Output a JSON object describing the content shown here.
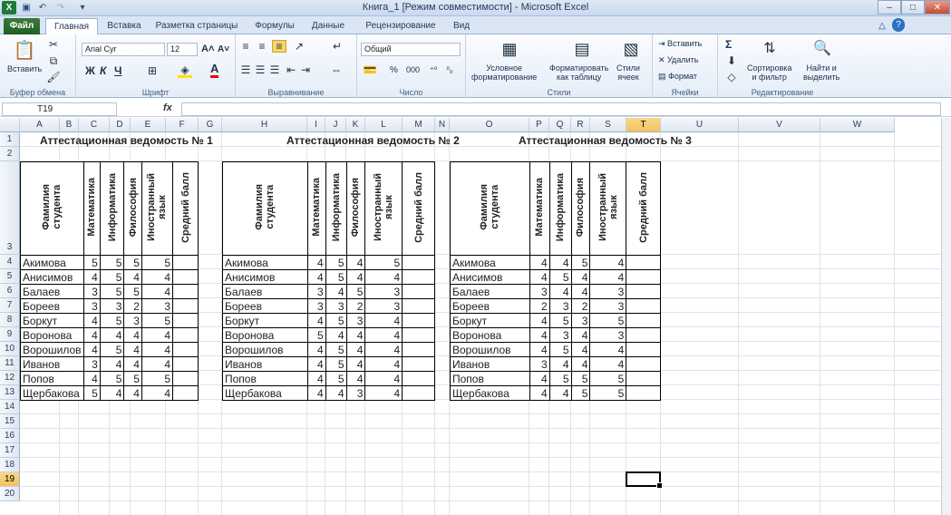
{
  "window": {
    "title": "Книга_1  [Режим совместимости]  -  Microsoft Excel",
    "minimize": "–",
    "maximize": "□",
    "close": "✕"
  },
  "tabs": [
    "Файл",
    "Главная",
    "Вставка",
    "Разметка страницы",
    "Формулы",
    "Данные",
    "Рецензирование",
    "Вид"
  ],
  "ribbon": {
    "clipboard": {
      "paste": "Вставить",
      "label": "Буфер обмена"
    },
    "font": {
      "name": "Arial Cyr",
      "size": "12",
      "bold": "Ж",
      "italic": "К",
      "underline": "Ч",
      "label": "Шрифт",
      "grow": "A˄",
      "shrink": "A˅",
      "color_a": "A"
    },
    "alignment": {
      "label": "Выравнивание"
    },
    "number": {
      "format": "Общий",
      "percent": "%",
      "thousands": "000",
      "label": "Число"
    },
    "styles": {
      "conditional": "Условное\nформатирование",
      "as_table": "Форматировать\nкак таблицу",
      "cell_styles": "Стили\nячеек",
      "label": "Стили"
    },
    "cells": {
      "insert": "Вставить",
      "delete": "Удалить",
      "format": "Формат",
      "label": "Ячейки"
    },
    "editing": {
      "sum": "Σ",
      "sort": "Сортировка\nи фильтр",
      "find": "Найти и\nвыделить",
      "label": "Редактирование"
    }
  },
  "formula_bar": {
    "name_box": "T19",
    "fx": "fx",
    "formula": ""
  },
  "columns": [
    "A",
    "B",
    "C",
    "D",
    "E",
    "F",
    "G",
    "H",
    "I",
    "J",
    "K",
    "L",
    "M",
    "N",
    "O",
    "P",
    "Q",
    "R",
    "S",
    "T",
    "U",
    "V",
    "W"
  ],
  "rows": [
    "1",
    "2",
    "3",
    "4",
    "5",
    "6",
    "7",
    "8",
    "9",
    "10",
    "11",
    "12",
    "13",
    "14",
    "15",
    "16",
    "17",
    "18",
    "19",
    "20"
  ],
  "selected_cell": "T19",
  "header_labels": [
    "Фамилия\nстудента",
    "Математика",
    "Информатика",
    "Философия",
    "Иностранный\nязык",
    "Средний балл"
  ],
  "tables": [
    {
      "title": "Аттестационная ведомость № 1",
      "rows": [
        [
          "Акимова",
          "5",
          "5",
          "5",
          "5"
        ],
        [
          "Анисимов",
          "4",
          "5",
          "4",
          "4"
        ],
        [
          "Балаев",
          "3",
          "5",
          "5",
          "4"
        ],
        [
          "Бореев",
          "3",
          "3",
          "2",
          "3"
        ],
        [
          "Боркут",
          "4",
          "5",
          "3",
          "5"
        ],
        [
          "Воронова",
          "4",
          "4",
          "4",
          "4"
        ],
        [
          "Ворошилов",
          "4",
          "5",
          "4",
          "4"
        ],
        [
          "Иванов",
          "3",
          "4",
          "4",
          "4"
        ],
        [
          "Попов",
          "4",
          "5",
          "5",
          "5"
        ],
        [
          "Щербакова",
          "5",
          "4",
          "4",
          "4"
        ]
      ]
    },
    {
      "title": "Аттестационная ведомость № 2",
      "rows": [
        [
          "Акимова",
          "4",
          "5",
          "4",
          "5"
        ],
        [
          "Анисимов",
          "4",
          "5",
          "4",
          "4"
        ],
        [
          "Балаев",
          "3",
          "4",
          "5",
          "3"
        ],
        [
          "Бореев",
          "3",
          "3",
          "2",
          "3"
        ],
        [
          "Боркут",
          "4",
          "5",
          "3",
          "4"
        ],
        [
          "Воронова",
          "5",
          "4",
          "4",
          "4"
        ],
        [
          "Ворошилов",
          "4",
          "5",
          "4",
          "4"
        ],
        [
          "Иванов",
          "4",
          "5",
          "4",
          "4"
        ],
        [
          "Попов",
          "4",
          "5",
          "4",
          "4"
        ],
        [
          "Щербакова",
          "4",
          "4",
          "3",
          "4"
        ]
      ]
    },
    {
      "title": "Аттестационная ведомость № 3",
      "rows": [
        [
          "Акимова",
          "4",
          "4",
          "5",
          "4"
        ],
        [
          "Анисимов",
          "4",
          "5",
          "4",
          "4"
        ],
        [
          "Балаев",
          "3",
          "4",
          "4",
          "3"
        ],
        [
          "Бореев",
          "2",
          "3",
          "2",
          "3"
        ],
        [
          "Боркут",
          "4",
          "5",
          "3",
          "5"
        ],
        [
          "Воронова",
          "4",
          "3",
          "4",
          "3"
        ],
        [
          "Ворошилов",
          "4",
          "5",
          "4",
          "4"
        ],
        [
          "Иванов",
          "3",
          "4",
          "4",
          "4"
        ],
        [
          "Попов",
          "4",
          "5",
          "5",
          "5"
        ],
        [
          "Щербакова",
          "4",
          "4",
          "5",
          "5"
        ]
      ]
    }
  ]
}
